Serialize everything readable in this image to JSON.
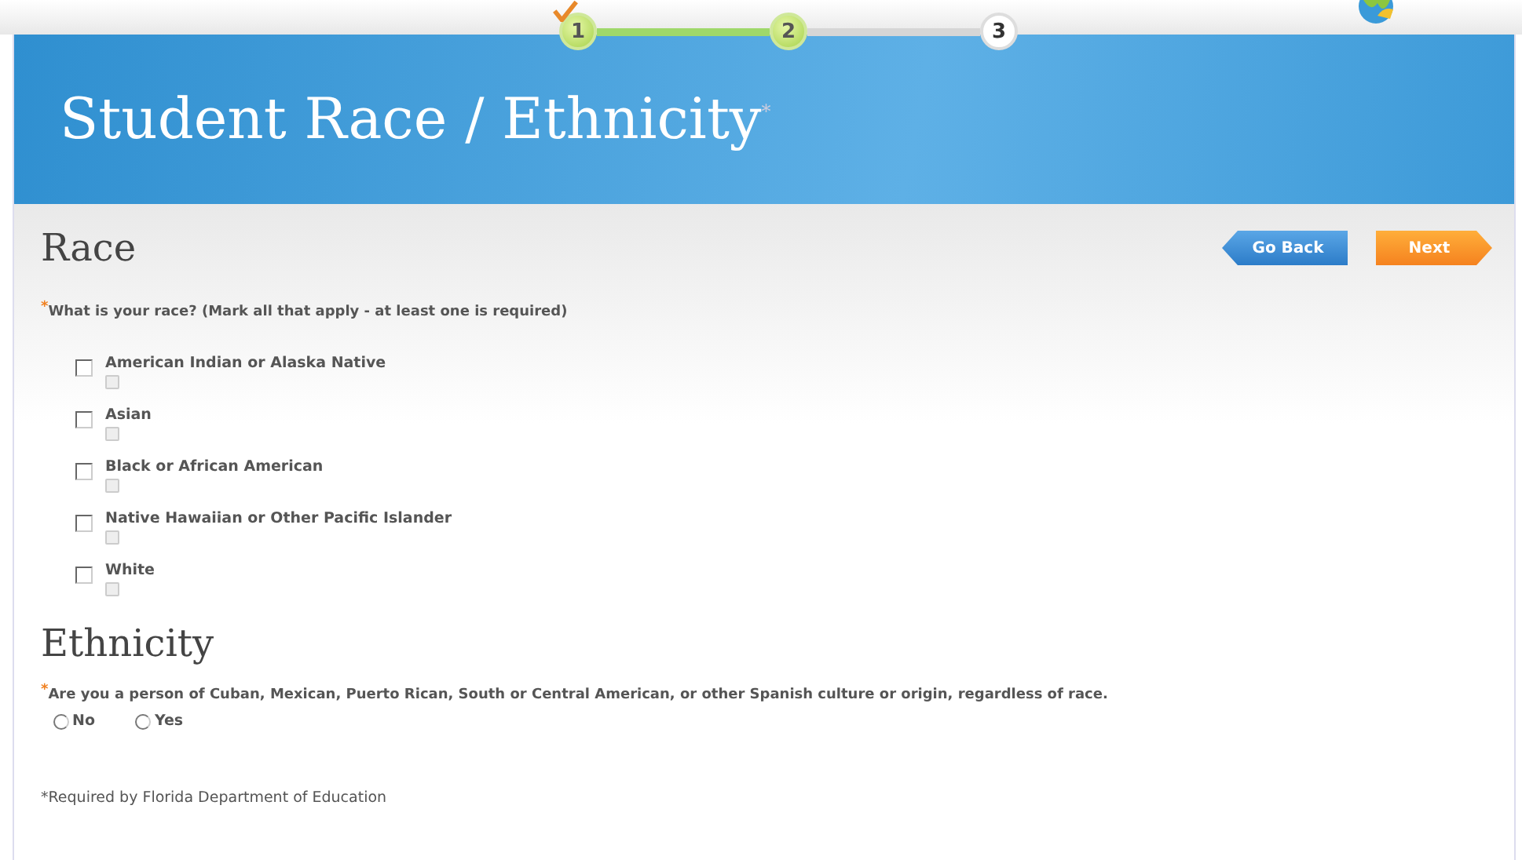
{
  "steps": [
    {
      "label": "1",
      "completed": true,
      "reached": true
    },
    {
      "label": "2",
      "completed": false,
      "reached": true
    },
    {
      "label": "3",
      "completed": false,
      "reached": false
    }
  ],
  "header": {
    "title": "Student Race / Ethnicity$^{*}$"
  },
  "race": {
    "heading": "Race",
    "buttons": [
      {
        "label": "Go Back",
        "kind": "back"
      },
      {
        "label": "Next",
        "kind": "next"
      }
    ],
    "required_mark": "*",
    "question": "What is your race? (Mark all that apply - at least one is required)",
    "options": [
      {
        "label": "American Indian or Alaska Native",
        "checked": false
      },
      {
        "label": "Asian",
        "checked": false
      },
      {
        "label": "Black or African American",
        "checked": false
      },
      {
        "label": "Native Hawaiian or Other Pacific Islander",
        "checked": false
      },
      {
        "label": "White",
        "checked": false
      }
    ]
  },
  "ethnicity": {
    "heading": "Ethnicity",
    "required_mark": "*",
    "question": "Are you a person of Cuban, Mexican, Puerto Rican, South or Central American, or other Spanish culture or origin, regardless of race.",
    "options": [
      {
        "label": "No",
        "selected": false
      },
      {
        "label": "Yes",
        "selected": false
      }
    ]
  },
  "footnote": "*Required by Florida Department of Education"
}
